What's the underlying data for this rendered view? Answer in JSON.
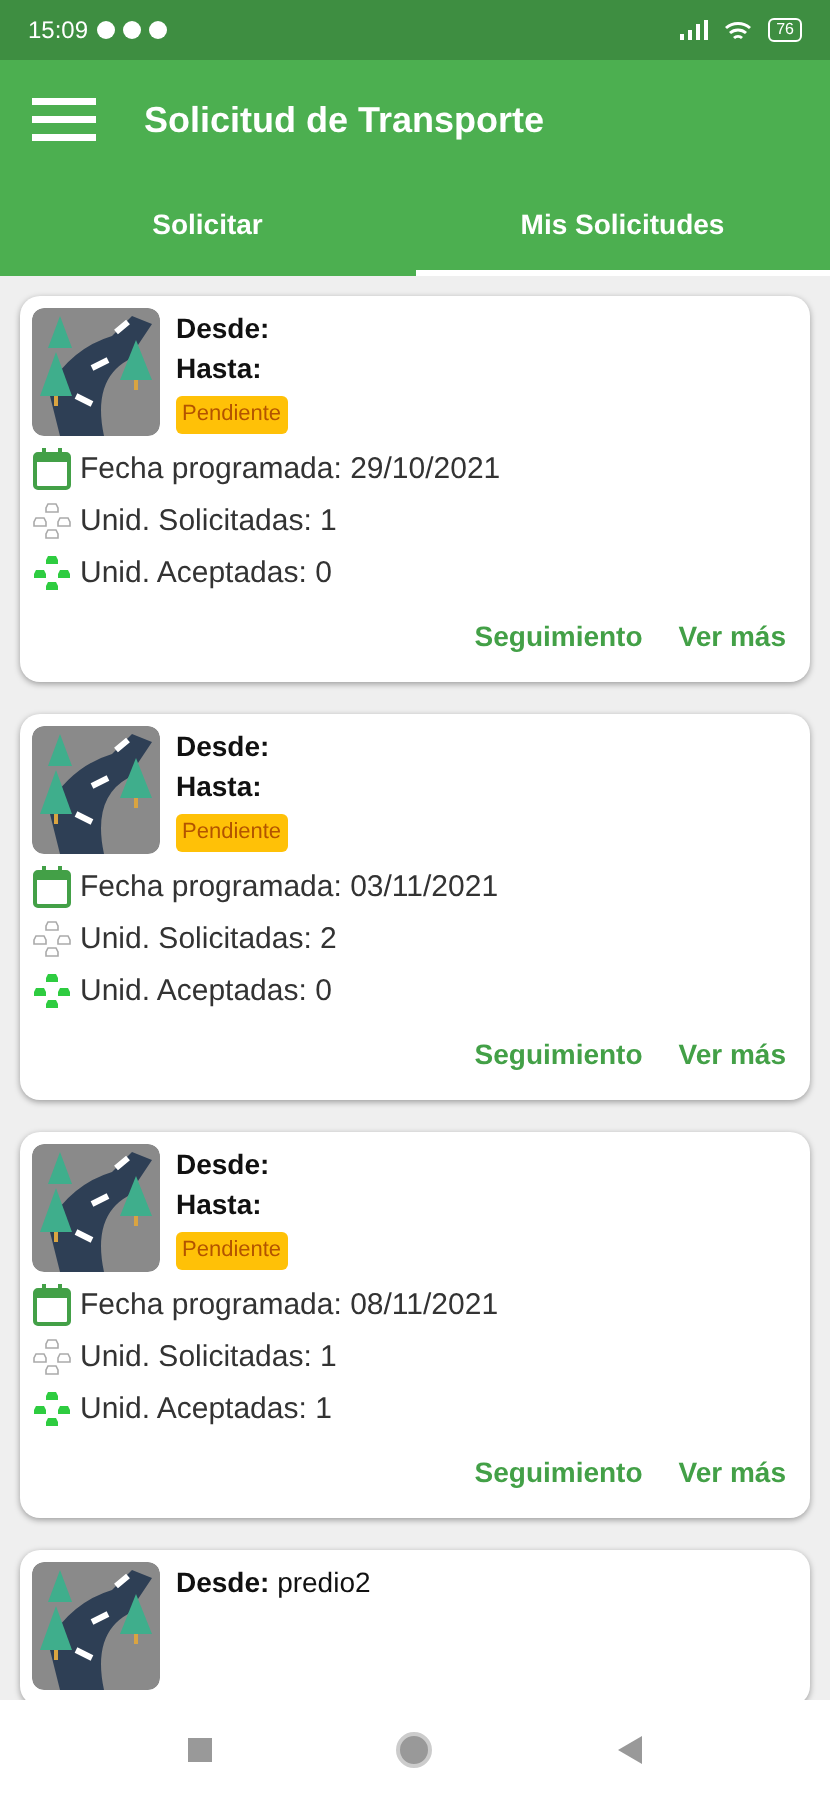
{
  "status_bar": {
    "time": "15:09",
    "battery": "76"
  },
  "app_bar": {
    "title": "Solicitud de Transporte"
  },
  "tabs": [
    {
      "label": "Solicitar",
      "selected": false
    },
    {
      "label": "Mis Solicitudes",
      "selected": true
    }
  ],
  "requests": [
    {
      "from_label": "Desde:",
      "to_label": "Hasta:",
      "status": "Pendiente",
      "date": "Fecha programada: 29/10/2021",
      "requested": "Unid. Solicitadas: 1",
      "accepted": "Unid. Aceptadas: 0",
      "actions": [
        "Seguimiento",
        "Ver más"
      ]
    },
    {
      "from_label": "Desde:",
      "to_label": "Hasta:",
      "status": "Pendiente",
      "date": "Fecha programada: 03/11/2021",
      "requested": "Unid. Solicitadas: 2",
      "accepted": "Unid. Aceptadas: 0",
      "actions": [
        "Seguimiento",
        "Ver más"
      ]
    },
    {
      "from_label": "Desde:",
      "to_label": "Hasta:",
      "status": "Pendiente",
      "date": "Fecha programada: 08/11/2021",
      "requested": "Unid. Solicitadas: 1",
      "accepted": "Unid. Aceptadas: 1",
      "actions": [
        "Seguimiento",
        "Ver más"
      ]
    },
    {
      "from_label": "Desde:",
      "from": "predio2"
    }
  ]
}
